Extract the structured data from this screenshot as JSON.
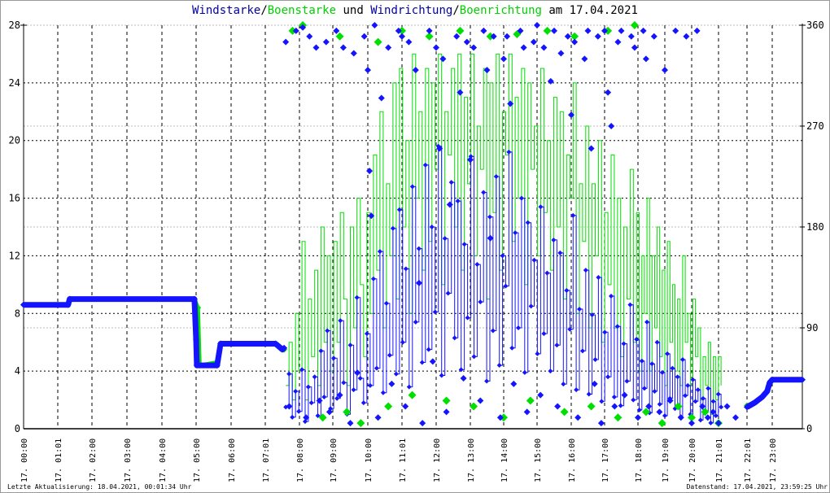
{
  "chart_data": {
    "type": "line",
    "title_parts": {
      "wind": "Windstarke",
      "sep1": "/",
      "gust": "Boenstarke",
      "und": " und ",
      "dir": "Windrichtung",
      "sep2": "/",
      "gustdir": "Boenrichtung",
      "date": " am 17.04.2021"
    },
    "y_left": {
      "range": [
        0,
        28
      ],
      "ticks": [
        "0",
        "4",
        "8",
        "12",
        "16",
        "20",
        "24",
        "28"
      ]
    },
    "y_right": {
      "range": [
        0,
        360
      ],
      "ticks": [
        "0",
        "90",
        "180",
        "270",
        "360"
      ]
    },
    "x_ticks": [
      {
        "label": "17. 00:00",
        "hour": 0
      },
      {
        "label": "17. 01:01",
        "hour": 1
      },
      {
        "label": "17. 02:00",
        "hour": 2
      },
      {
        "label": "17. 03:00",
        "hour": 3
      },
      {
        "label": "17. 04:00",
        "hour": 4
      },
      {
        "label": "17. 05:00",
        "hour": 5
      },
      {
        "label": "17. 06:00",
        "hour": 6
      },
      {
        "label": "17. 07:01",
        "hour": 7
      },
      {
        "label": "17. 08:00",
        "hour": 8
      },
      {
        "label": "17. 09:00",
        "hour": 9
      },
      {
        "label": "17. 10:00",
        "hour": 10
      },
      {
        "label": "17. 11:01",
        "hour": 11
      },
      {
        "label": "17. 12:00",
        "hour": 12
      },
      {
        "label": "17. 13:00",
        "hour": 13
      },
      {
        "label": "17. 14:00",
        "hour": 14
      },
      {
        "label": "17. 15:00",
        "hour": 15
      },
      {
        "label": "17. 16:00",
        "hour": 16
      },
      {
        "label": "17. 17:00",
        "hour": 17
      },
      {
        "label": "17. 18:00",
        "hour": 18
      },
      {
        "label": "17. 19:00",
        "hour": 19
      },
      {
        "label": "17. 20:00",
        "hour": 20
      },
      {
        "label": "17. 21:01",
        "hour": 21
      },
      {
        "label": "17. 22:01",
        "hour": 22
      },
      {
        "label": "17. 23:00",
        "hour": 23
      }
    ],
    "colors": {
      "wind": "#1414ff",
      "gust": "#00e000",
      "title_wind": "#0000a8"
    },
    "calm_wind": [
      [
        0,
        8.6
      ],
      [
        1.3,
        8.6
      ],
      [
        1.35,
        9.0
      ],
      [
        4.95,
        9.0
      ],
      [
        5.0,
        6.2
      ],
      [
        5.02,
        4.4
      ],
      [
        5.6,
        4.4
      ],
      [
        5.7,
        5.9
      ],
      [
        7.3,
        5.9
      ],
      [
        7.5,
        5.5
      ],
      [
        7.55,
        5.6
      ]
    ],
    "calm_gust": [
      [
        0,
        8.6
      ],
      [
        1.3,
        8.6
      ],
      [
        1.35,
        9.0
      ],
      [
        4.95,
        9.0
      ],
      [
        5.05,
        8.4
      ],
      [
        5.1,
        4.4
      ],
      [
        5.6,
        4.6
      ],
      [
        5.7,
        5.9
      ],
      [
        7.3,
        5.9
      ],
      [
        7.55,
        5.5
      ]
    ],
    "tail_wind": [
      [
        22.0,
        1.5
      ],
      [
        22.3,
        1.8
      ],
      [
        22.6,
        2.2
      ],
      [
        22.8,
        2.6
      ],
      [
        22.9,
        3.2
      ],
      [
        23.0,
        3.4
      ],
      [
        24.0,
        3.4
      ]
    ],
    "tail_gust": [
      [
        22.0,
        1.6
      ],
      [
        22.4,
        1.9
      ],
      [
        22.7,
        2.4
      ],
      [
        22.85,
        2.9
      ],
      [
        22.95,
        3.3
      ],
      [
        23.0,
        3.4
      ],
      [
        24.0,
        3.4
      ]
    ],
    "active": {
      "start": 7.6,
      "step": 0.095,
      "wind": [
        1.5,
        3.8,
        0.8,
        2.6,
        1.2,
        4.1,
        0.5,
        2.9,
        1.8,
        3.6,
        0.9,
        5.4,
        2.2,
        6.8,
        1.4,
        4.9,
        2.1,
        7.5,
        3.2,
        1.0,
        5.8,
        2.7,
        9.1,
        3.5,
        1.8,
        6.6,
        3.0,
        10.4,
        4.2,
        12.3,
        2.5,
        8.7,
        5.1,
        13.9,
        3.8,
        15.2,
        6.0,
        11.1,
        2.9,
        16.8,
        7.4,
        12.5,
        4.6,
        18.3,
        5.5,
        14.0,
        8.1,
        19.6,
        3.7,
        13.2,
        9.4,
        17.1,
        6.3,
        15.8,
        4.1,
        12.8,
        7.7,
        18.9,
        5.0,
        11.4,
        8.8,
        16.4,
        3.3,
        14.7,
        6.8,
        17.5,
        4.4,
        12.0,
        9.9,
        19.2,
        5.6,
        13.6,
        7.0,
        16.0,
        3.9,
        14.3,
        8.5,
        11.7,
        5.2,
        15.4,
        6.6,
        10.8,
        4.0,
        13.1,
        5.8,
        12.2,
        3.1,
        9.6,
        6.9,
        14.8,
        2.7,
        8.3,
        5.4,
        11.0,
        2.4,
        7.9,
        4.8,
        10.5,
        1.9,
        6.7,
        3.6,
        9.2,
        2.2,
        7.1,
        1.6,
        5.9,
        3.3,
        8.6,
        2.0,
        6.2,
        1.3,
        4.7,
        2.8,
        7.4,
        1.1,
        4.5,
        2.6,
        6.0,
        1.7,
        3.9,
        0.9,
        5.2,
        2.1,
        4.2,
        1.4,
        3.6,
        0.8,
        4.8,
        2.3,
        3.0,
        1.0,
        3.4,
        1.9,
        2.7,
        0.6,
        2.1,
        1.2,
        2.8,
        0.4,
        1.9,
        0.9,
        2.4,
        1.5
      ],
      "gust": [
        3,
        6,
        2,
        8,
        4,
        13,
        2,
        9,
        5,
        11,
        3,
        14,
        6,
        12,
        4,
        13,
        6,
        15,
        9,
        3,
        14,
        7,
        16,
        10,
        5,
        15,
        8,
        19,
        11,
        22,
        7,
        17,
        12,
        24,
        9,
        25,
        14,
        20,
        8,
        26,
        16,
        22,
        11,
        25,
        13,
        24,
        18,
        26,
        10,
        22,
        19,
        25,
        14,
        26,
        11,
        23,
        17,
        26,
        12,
        21,
        18,
        25,
        9,
        24,
        15,
        26,
        11,
        22,
        19,
        26,
        13,
        23,
        16,
        25,
        10,
        24,
        18,
        21,
        12,
        25,
        15,
        20,
        11,
        23,
        14,
        22,
        9,
        19,
        16,
        24,
        8,
        17,
        13,
        21,
        7,
        17,
        12,
        20,
        6,
        15,
        10,
        19,
        7,
        16,
        5,
        14,
        9,
        18,
        6,
        15,
        4,
        12,
        8,
        16,
        4,
        12,
        7,
        14,
        5,
        11,
        3,
        13,
        6,
        10,
        4,
        9,
        3,
        12,
        6,
        8,
        3,
        9,
        5,
        7,
        2,
        5,
        3,
        6,
        1,
        5,
        2,
        5,
        3
      ]
    },
    "wind_direction": [
      [
        7.6,
        345
      ],
      [
        7.7,
        20
      ],
      [
        7.9,
        355
      ],
      [
        8.1,
        358
      ],
      [
        8.2,
        10
      ],
      [
        8.3,
        350
      ],
      [
        8.5,
        340
      ],
      [
        8.6,
        25
      ],
      [
        8.8,
        345
      ],
      [
        8.9,
        15
      ],
      [
        9.1,
        355
      ],
      [
        9.2,
        30
      ],
      [
        9.3,
        340
      ],
      [
        9.5,
        5
      ],
      [
        9.6,
        335
      ],
      [
        9.7,
        50
      ],
      [
        9.9,
        350
      ],
      [
        10.0,
        320
      ],
      [
        10.05,
        230
      ],
      [
        10.1,
        190
      ],
      [
        10.2,
        360
      ],
      [
        10.3,
        10
      ],
      [
        10.4,
        295
      ],
      [
        10.6,
        340
      ],
      [
        10.7,
        40
      ],
      [
        10.9,
        355
      ],
      [
        11.0,
        350
      ],
      [
        11.1,
        20
      ],
      [
        11.2,
        345
      ],
      [
        11.4,
        320
      ],
      [
        11.5,
        130
      ],
      [
        11.6,
        5
      ],
      [
        11.8,
        355
      ],
      [
        11.9,
        60
      ],
      [
        12.0,
        340
      ],
      [
        12.1,
        250
      ],
      [
        12.2,
        330
      ],
      [
        12.3,
        15
      ],
      [
        12.4,
        200
      ],
      [
        12.6,
        350
      ],
      [
        12.7,
        300
      ],
      [
        12.8,
        45
      ],
      [
        12.9,
        345
      ],
      [
        13.0,
        240
      ],
      [
        13.1,
        340
      ],
      [
        13.3,
        25
      ],
      [
        13.4,
        355
      ],
      [
        13.5,
        320
      ],
      [
        13.6,
        170
      ],
      [
        13.7,
        350
      ],
      [
        13.9,
        10
      ],
      [
        14.0,
        330
      ],
      [
        14.1,
        350
      ],
      [
        14.2,
        290
      ],
      [
        14.3,
        40
      ],
      [
        14.5,
        355
      ],
      [
        14.6,
        340
      ],
      [
        14.7,
        15
      ],
      [
        14.9,
        345
      ],
      [
        15.0,
        360
      ],
      [
        15.1,
        30
      ],
      [
        15.2,
        340
      ],
      [
        15.4,
        310
      ],
      [
        15.5,
        355
      ],
      [
        15.6,
        20
      ],
      [
        15.7,
        335
      ],
      [
        15.9,
        350
      ],
      [
        16.0,
        280
      ],
      [
        16.1,
        345
      ],
      [
        16.2,
        10
      ],
      [
        16.4,
        330
      ],
      [
        16.5,
        355
      ],
      [
        16.6,
        250
      ],
      [
        16.7,
        40
      ],
      [
        16.8,
        350
      ],
      [
        16.9,
        5
      ],
      [
        17.0,
        355
      ],
      [
        17.1,
        300
      ],
      [
        17.2,
        270
      ],
      [
        17.3,
        20
      ],
      [
        17.4,
        345
      ],
      [
        17.5,
        355
      ],
      [
        17.6,
        30
      ],
      [
        17.8,
        350
      ],
      [
        17.9,
        340
      ],
      [
        18.0,
        10
      ],
      [
        18.2,
        355
      ],
      [
        18.3,
        330
      ],
      [
        18.4,
        20
      ],
      [
        18.6,
        350
      ],
      [
        18.8,
        15
      ],
      [
        19.0,
        320
      ],
      [
        19.2,
        25
      ],
      [
        19.4,
        355
      ],
      [
        19.6,
        10
      ],
      [
        19.8,
        350
      ],
      [
        20.0,
        5
      ],
      [
        20.2,
        355
      ],
      [
        20.4,
        20
      ],
      [
        20.6,
        10
      ],
      [
        20.8,
        15
      ],
      [
        21.0,
        5
      ],
      [
        21.3,
        20
      ],
      [
        21.6,
        10
      ]
    ],
    "gust_direction": [
      [
        7.8,
        355
      ],
      [
        8.1,
        360
      ],
      [
        8.7,
        10
      ],
      [
        9.2,
        350
      ],
      [
        9.4,
        15
      ],
      [
        9.8,
        5
      ],
      [
        10.3,
        345
      ],
      [
        10.6,
        20
      ],
      [
        11.0,
        355
      ],
      [
        11.3,
        30
      ],
      [
        11.8,
        350
      ],
      [
        12.3,
        25
      ],
      [
        12.7,
        355
      ],
      [
        13.1,
        20
      ],
      [
        13.6,
        350
      ],
      [
        14.0,
        10
      ],
      [
        14.4,
        352
      ],
      [
        14.8,
        25
      ],
      [
        15.3,
        355
      ],
      [
        15.8,
        15
      ],
      [
        16.1,
        350
      ],
      [
        16.6,
        20
      ],
      [
        17.1,
        355
      ],
      [
        17.4,
        10
      ],
      [
        17.9,
        360
      ],
      [
        18.3,
        15
      ],
      [
        18.9,
        5
      ],
      [
        19.5,
        20
      ],
      [
        20.0,
        10
      ],
      [
        20.5,
        15
      ],
      [
        21.0,
        5
      ]
    ],
    "footer_left": "Letzte Aktualisierung: 18.04.2021, 00:01:34 Uhr",
    "footer_right": "Datenstand: 17.04.2021, 23:59:25 Uhr"
  }
}
